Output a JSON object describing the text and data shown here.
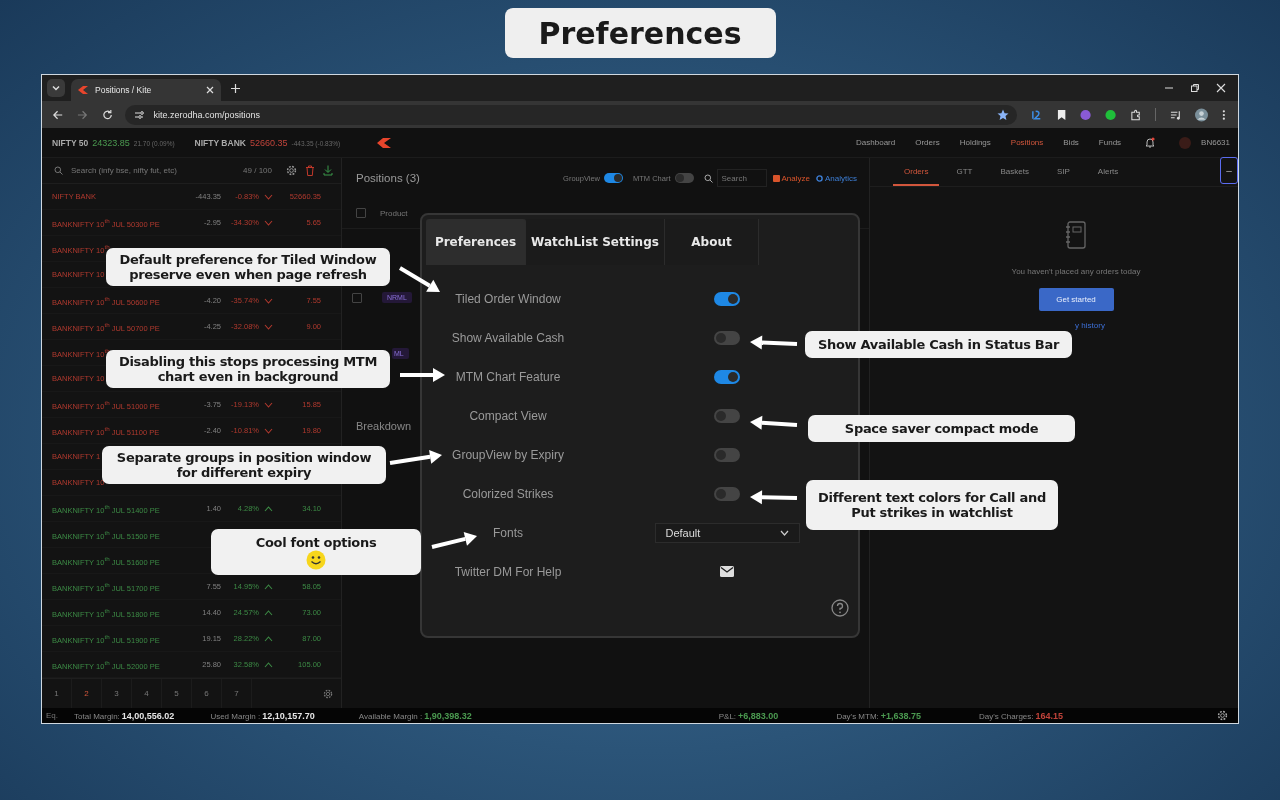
{
  "page_title": "Preferences",
  "browser": {
    "tab_title": "Positions / Kite",
    "url": "kite.zerodha.com/positions"
  },
  "indices": [
    {
      "name": "NIFTY 50",
      "value": "24323.85",
      "change": "21.70 (0.09%)",
      "negative": false
    },
    {
      "name": "NIFTY BANK",
      "value": "52660.35",
      "change": "-443.35 (-0.83%)",
      "negative": true
    }
  ],
  "nav": [
    {
      "label": "Dashboard",
      "selected": false
    },
    {
      "label": "Orders",
      "selected": false
    },
    {
      "label": "Holdings",
      "selected": false
    },
    {
      "label": "Positions",
      "selected": true
    },
    {
      "label": "Bids",
      "selected": false
    },
    {
      "label": "Funds",
      "selected": false
    }
  ],
  "user_id": "BN6631",
  "watchlist": {
    "search_placeholder": "Search (infy bse, nifty fut, etc)",
    "count": "49 / 100",
    "rows": [
      {
        "name": "NIFTY BANK",
        "negative": true,
        "change": "-443.35",
        "pct": "-0.83%",
        "price": "52660.35"
      },
      {
        "name": "BANKNIFTY 10$^{th}$ JUL 50300 PE",
        "negative": true,
        "change": "-2.95",
        "pct": "-34.30%",
        "price": "5.65"
      },
      {
        "name": "BANKNIFTY 10$^{th}$",
        "negative": true
      },
      {
        "name": "BANKNIFTY 10",
        "negative": true
      },
      {
        "name": "BANKNIFTY 10$^{th}$ JUL 50600 PE",
        "negative": true,
        "change": "-4.20",
        "pct": "-35.74%",
        "price": "7.55"
      },
      {
        "name": "BANKNIFTY 10$^{th}$ JUL 50700 PE",
        "negative": true,
        "change": "-4.25",
        "pct": "-32.08%",
        "price": "9.00"
      },
      {
        "name": "BANKNIFTY 10$^{th}$",
        "negative": true
      },
      {
        "name": "BANKNIFTY 10",
        "negative": true
      },
      {
        "name": "BANKNIFTY 10$^{th}$ JUL 51000 PE",
        "negative": true,
        "change": "-3.75",
        "pct": "-19.13%",
        "price": "15.85"
      },
      {
        "name": "BANKNIFTY 10$^{th}$ JUL 51100 PE",
        "negative": true,
        "change": "-2.40",
        "pct": "-10.81%",
        "price": "19.80"
      },
      {
        "name": "BANKNIFTY 1",
        "negative": true
      },
      {
        "name": "BANKNIFTY 10",
        "negative": true
      },
      {
        "name": "BANKNIFTY 10$^{th}$ JUL 51400 PE",
        "negative": false,
        "change": "1.40",
        "pct": "4.28%",
        "price": "34.10"
      },
      {
        "name": "BANKNIFTY 10$^{th}$ JUL 51500 PE",
        "negative": false
      },
      {
        "name": "BANKNIFTY 10$^{th}$ JUL 51600 PE",
        "negative": false
      },
      {
        "name": "BANKNIFTY 10$^{th}$ JUL 51700 PE",
        "negative": false,
        "change": "7.55",
        "pct": "14.95%",
        "price": "58.05"
      },
      {
        "name": "BANKNIFTY 10$^{th}$ JUL 51800 PE",
        "negative": false,
        "change": "14.40",
        "pct": "24.57%",
        "price": "73.00"
      },
      {
        "name": "BANKNIFTY 10$^{th}$ JUL 51900 PE",
        "negative": false,
        "change": "19.15",
        "pct": "28.22%",
        "price": "87.00"
      },
      {
        "name": "BANKNIFTY 10$^{th}$ JUL 52000 PE",
        "negative": false,
        "change": "25.80",
        "pct": "32.58%",
        "price": "105.00"
      }
    ],
    "pages": [
      {
        "label": "1",
        "selected": false
      },
      {
        "label": "2",
        "selected": true
      },
      {
        "label": "3",
        "selected": false
      },
      {
        "label": "4",
        "selected": false
      },
      {
        "label": "5",
        "selected": false
      },
      {
        "label": "6",
        "selected": false
      },
      {
        "label": "7",
        "selected": false
      }
    ]
  },
  "positions": {
    "title": "Positions (3)",
    "toggles": [
      {
        "label": "GroupView",
        "on": true
      },
      {
        "label": "MTM Chart",
        "on": false
      }
    ],
    "search_placeholder": "Search",
    "links": [
      {
        "label": "Analyze",
        "kind": "analyze"
      },
      {
        "label": "Analytics",
        "kind": "analytics"
      }
    ],
    "header": {
      "label": "Product",
      "checked": false
    },
    "tags": [
      {
        "text": "NRML",
        "checked": false
      },
      {
        "text": "ML"
      }
    ],
    "breakdown": "Breakdown"
  },
  "dialog": {
    "tabs": [
      {
        "label": "Preferences",
        "selected": true
      },
      {
        "label": "WatchList Settings",
        "selected": false
      },
      {
        "label": "About",
        "selected": false
      }
    ],
    "settings": [
      {
        "kind": "toggle",
        "label": "Tiled Order Window",
        "on": true
      },
      {
        "kind": "toggle",
        "label": "Show Available Cash",
        "on": false
      },
      {
        "kind": "toggle",
        "label": "MTM Chart Feature",
        "on": true
      },
      {
        "kind": "toggle",
        "label": "Compact View",
        "on": false
      },
      {
        "kind": "toggle",
        "label": "GroupView by Expiry",
        "on": false
      },
      {
        "kind": "toggle",
        "label": "Colorized Strikes",
        "on": false
      },
      {
        "kind": "select",
        "label": "Fonts",
        "value": "Default"
      },
      {
        "kind": "mail",
        "label": "Twitter DM For Help"
      }
    ]
  },
  "orders_panel": {
    "tabs": [
      {
        "label": "Orders",
        "selected": true
      },
      {
        "label": "GTT",
        "selected": false
      },
      {
        "label": "Baskets",
        "selected": false
      },
      {
        "label": "SIP",
        "selected": false
      },
      {
        "label": "Alerts",
        "selected": false
      }
    ],
    "collapse": "–",
    "empty_text": "You haven't placed any orders today",
    "button": "Get started",
    "link": "y history"
  },
  "status_bar": {
    "segment": "Eq.",
    "items": [
      {
        "label": "Total Margin:",
        "value": "14,00,556.02",
        "color": "#e6e6e6"
      },
      {
        "label": "Used Margin :",
        "value": "12,10,157.70",
        "color": "#e6e6e6"
      },
      {
        "label": "Available Margin :",
        "value": "1,90,398.32",
        "color": "#4b9a50"
      },
      {
        "label": "P&L:",
        "value": "+6,883.00",
        "color": "#4b9a50"
      },
      {
        "label": "Day's MTM:",
        "value": "+1,638.75",
        "color": "#4b9a50"
      },
      {
        "label": "Day's Charges:",
        "value": "164.15",
        "color": "#c0433a"
      }
    ]
  },
  "callouts": [
    {
      "text": "Default preference for Tiled Window preserve even when page refresh"
    },
    {
      "text": "Disabling this stops processing MTM chart even in background"
    },
    {
      "text": "Separate groups in position window for different expiry"
    },
    {
      "text": "Cool font options",
      "emoji": true
    },
    {
      "text": "Show Available Cash in Status Bar"
    },
    {
      "text": "Space saver compact mode"
    },
    {
      "text": "Different text colors for Call and Put strikes in watchlist"
    }
  ]
}
